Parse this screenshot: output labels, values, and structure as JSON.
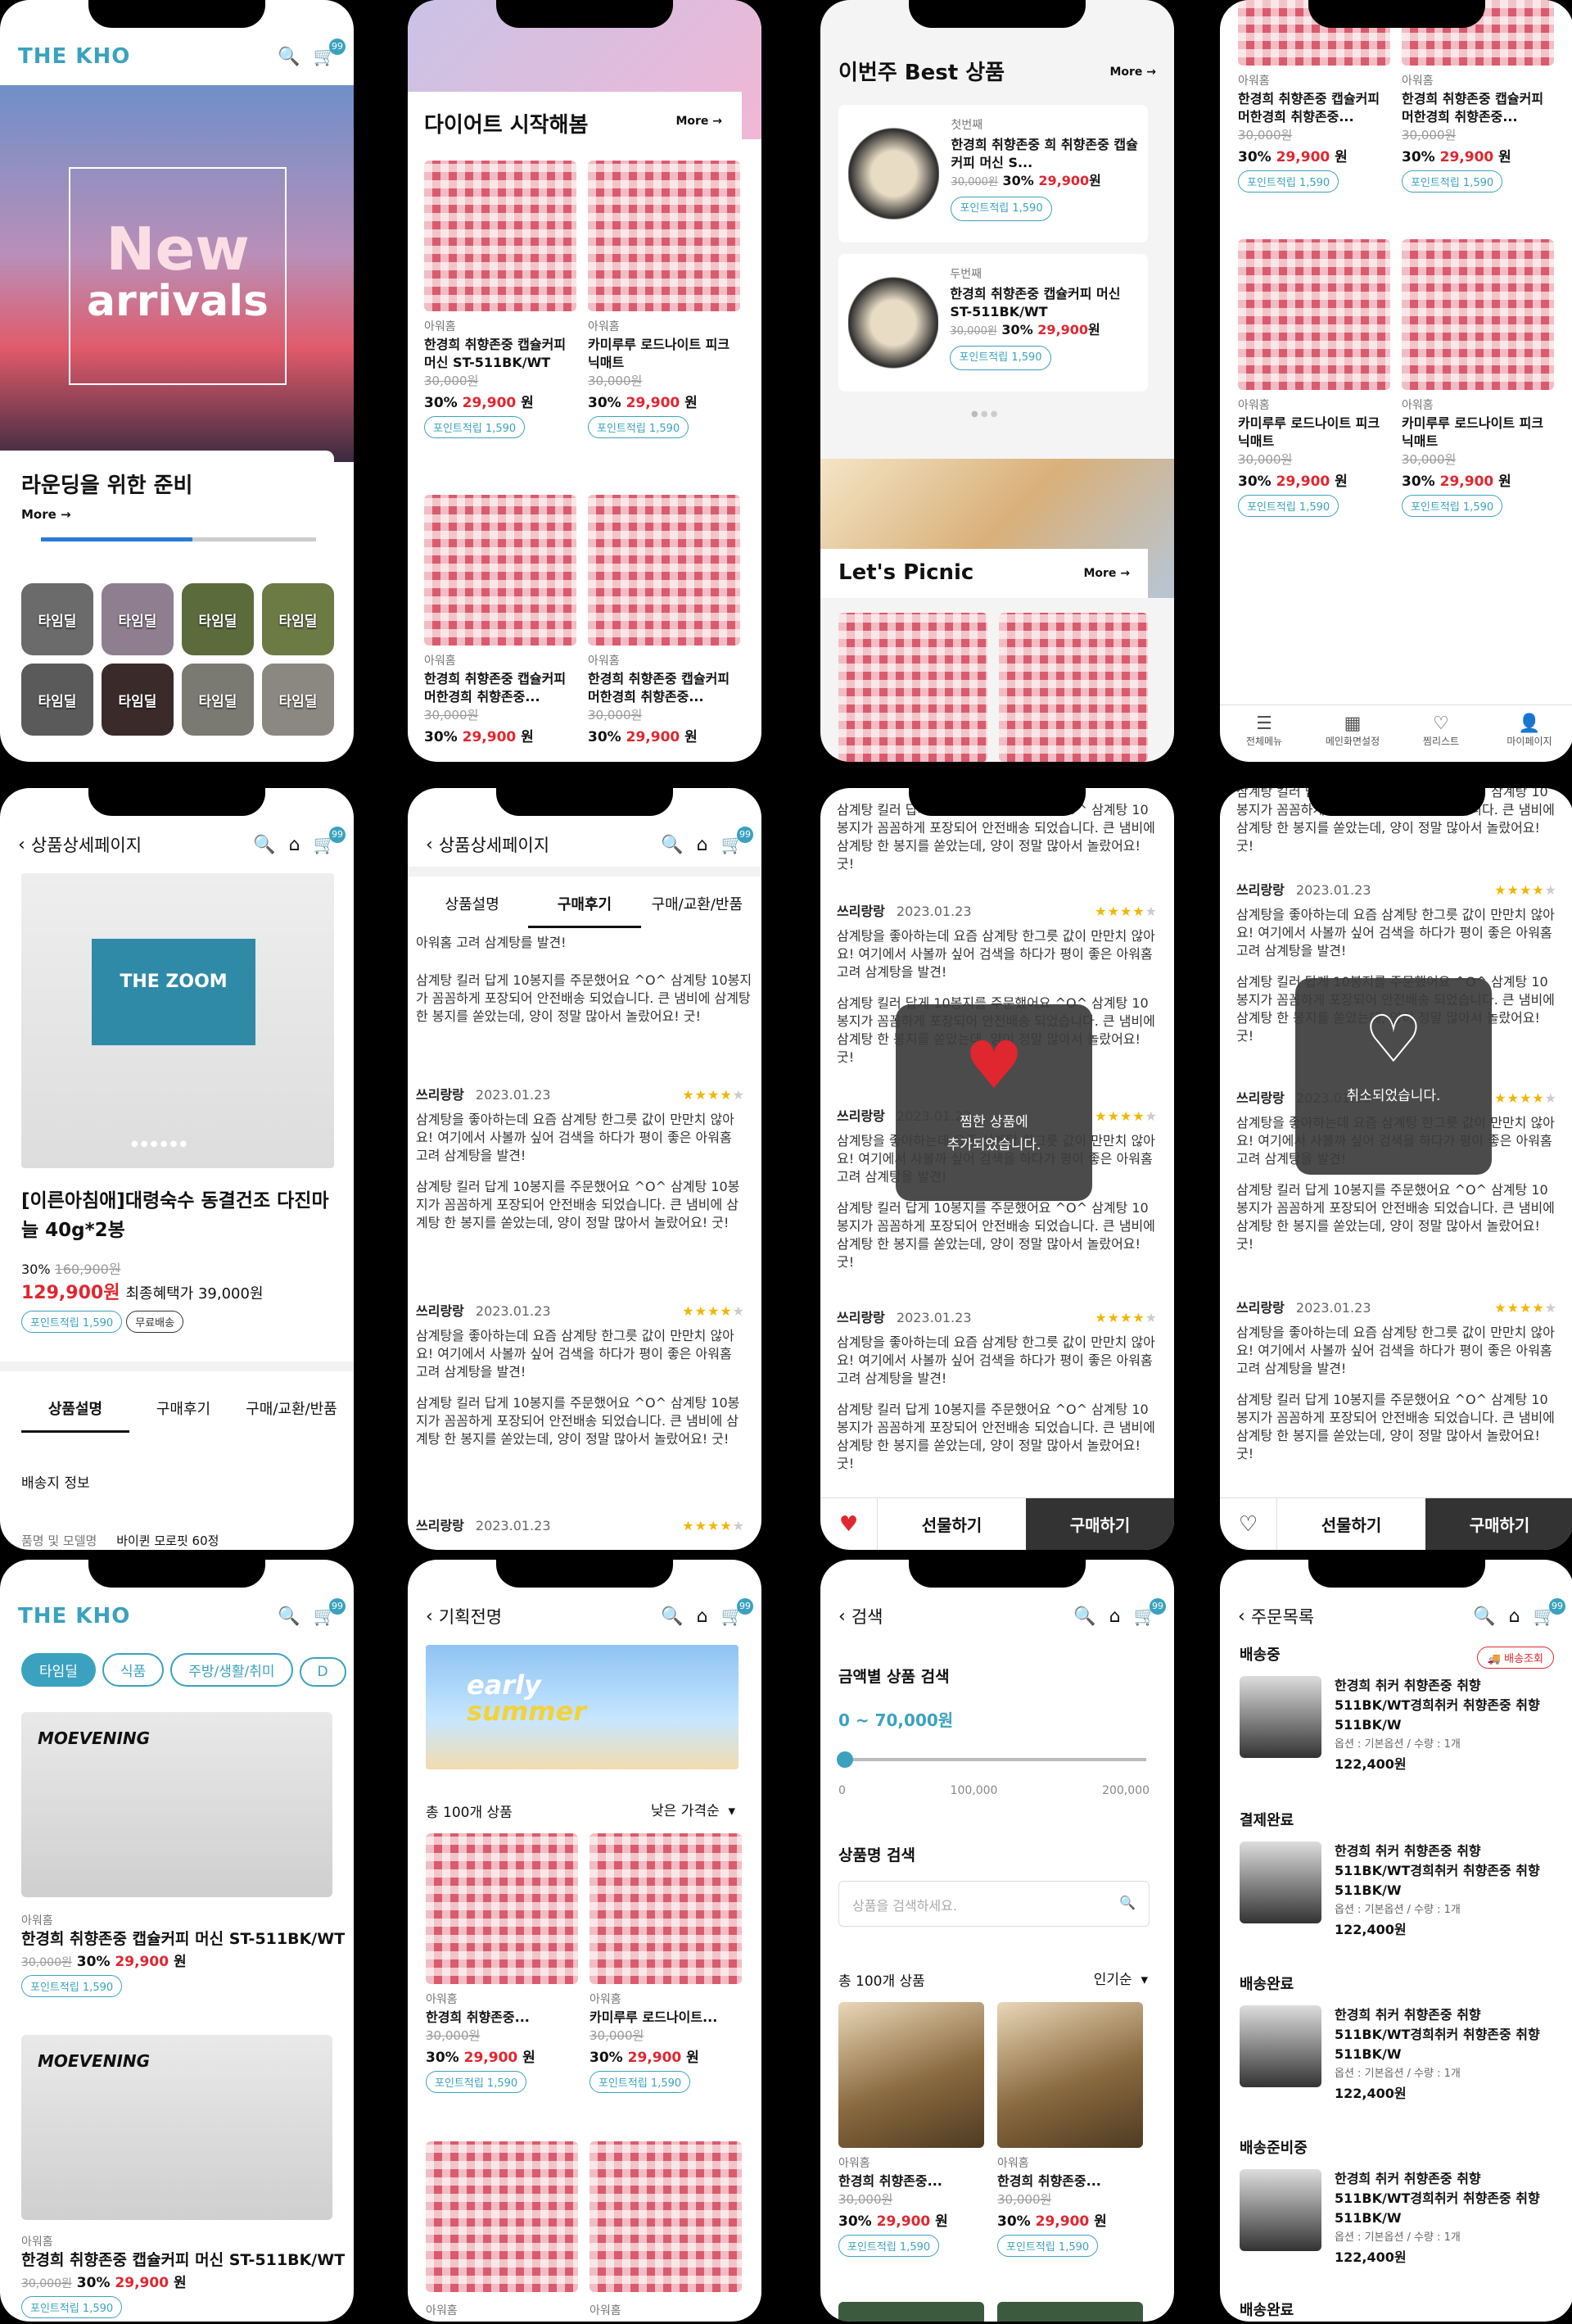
{
  "accent": "#3aa2bf",
  "sale_red": "#e0262f",
  "common": {
    "brand": "아워홈",
    "orig": "30,000원",
    "disc": "30%",
    "price": "29,900",
    "won": "원",
    "points": "포인트적립 1,590",
    "more": "More",
    "cart_count": "99",
    "p1": "한경희 취향존중 캡슐커피 머신 ST-511BK/WT",
    "p2": "카미루루 로드나이트 피크닉매트",
    "p3": "한경희 취향존중 캡슐커피 머한경희 취향존중...",
    "review_name": "쓰리랑랑",
    "review_date": "2023.01.23",
    "review_a": "삼계탕을 좋아하는데 요즘 삼계탕 한그릇 값이 만만치 않아요! 여기에서 사볼까 싶어 검색을 하다가 평이 좋은 아워홈 고려 삼계탕을 발견!",
    "review_b": "삼계탕 킬러 답게 10봉지를 주문했어요 ^O^ 삼계탕 10봉지가 꼼꼼하게 포장되어 안전배송 되었습니다. 큰 냄비에 삼계탕 한 봉지를 쏟았는데, 양이 정말 많아서 놀랐어요! 굿!"
  },
  "s1": {
    "logo": "THE KHO",
    "hero": [
      "New",
      "arrivals"
    ],
    "title": "라운딩을 위한 준비",
    "tile": "타임딜"
  },
  "s2": {
    "title": "다이어트 시작해봄"
  },
  "s3": {
    "title": "이번주 Best 상품",
    "rank1": "첫번째",
    "rank2": "두번째",
    "item": "한경희 취향존중 캡슐커피 머신 ST-511BK/WT",
    "item1": "한경희 취향존중 희 취향존중 캡슐커피 머신 S...",
    "picnic": "Let's Picnic"
  },
  "s4": {
    "nav": [
      "전체메뉴",
      "메인화면설정",
      "찜리스트",
      "마이페이지"
    ]
  },
  "s5": {
    "title": "상품상세페이지",
    "name": "[이른아침애]대령숙수 동결건조 다진마늘 40g*2봉",
    "disc": "30%",
    "orig": "160,900원",
    "price": "129,900원",
    "benefit": "최종혜택가 39,000원",
    "ship": "무료배송",
    "tabs": [
      "상품설명",
      "구매후기",
      "구매/교환/반품"
    ],
    "delivery": "배송지 정보",
    "spec_label": "품명 및 모델명",
    "spec_val": "바이퀸 모로핏 60정",
    "laptop": "THE ZOOM"
  },
  "s6": {
    "first_line": "아워홈 고려 삼계탕를 발견!"
  },
  "s7": {
    "toast": [
      "찜한 상품에",
      "추가되었습니다."
    ],
    "gift": "선물하기",
    "buy": "구매하기"
  },
  "s8": {
    "toast": "취소되었습니다."
  },
  "s9": {
    "chips": [
      "타임딜",
      "식품",
      "주방/생활/취미",
      "D"
    ],
    "brand_img": "MOEVENING"
  },
  "s10": {
    "title": "기획전명",
    "banner": [
      "early",
      "summer"
    ],
    "count": "총 100개 상품",
    "sort": "낮은 가격순",
    "n1": "한경희 취향존중...",
    "n2": "카미루루 로드나이트..."
  },
  "s11": {
    "title": "검색",
    "sec1": "금액별 상품 검색",
    "range": "0 ~ 70,000원",
    "ticks": [
      "0",
      "100,000",
      "200,000"
    ],
    "sec2": "상품명 검색",
    "placeholder": "상품을 검색하세요.",
    "count": "총 100개 상품",
    "sort": "인기순"
  },
  "s12": {
    "title": "주문목록",
    "track": "배송조회",
    "statuses": [
      "배송중",
      "결제완료",
      "배송완료",
      "배송준비중",
      "배송완료"
    ],
    "item": "한경희 취커 취향존중 취향511BK/WT경희취커 취향존중 취향511BK/W",
    "opt": "옵션 : 기본옵션 / 수량 : 1개",
    "price": "122,400원"
  }
}
